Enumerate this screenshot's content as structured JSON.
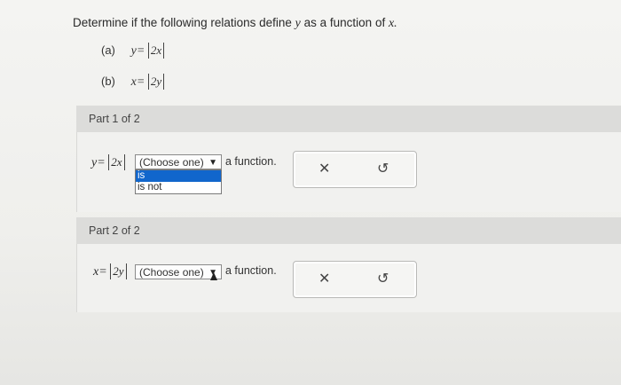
{
  "question": {
    "prompt_text": "Determine if the following relations define",
    "prompt_var": "y",
    "prompt_mid": "as a function of",
    "prompt_var2": "x.",
    "items": [
      {
        "label": "(a)",
        "lhs": "y=",
        "abs": "2x"
      },
      {
        "label": "(b)",
        "lhs": "x=",
        "abs": "2y"
      }
    ]
  },
  "parts": [
    {
      "header": "Part 1 of 2",
      "lhs": "y=",
      "abs": "2x",
      "select_label": "(Choose one)",
      "options": [
        "is",
        "is not"
      ],
      "suffix": "a function.",
      "clear_icon": "✕",
      "reset_icon": "↺"
    },
    {
      "header": "Part 2 of 2",
      "lhs": "x=",
      "abs": "2y",
      "select_label": "(Choose one)",
      "suffix": "a function.",
      "clear_icon": "✕",
      "reset_icon": "↺"
    }
  ],
  "colors": {
    "selected_option": "#1166cc",
    "header_bg": "#dcdcda"
  }
}
